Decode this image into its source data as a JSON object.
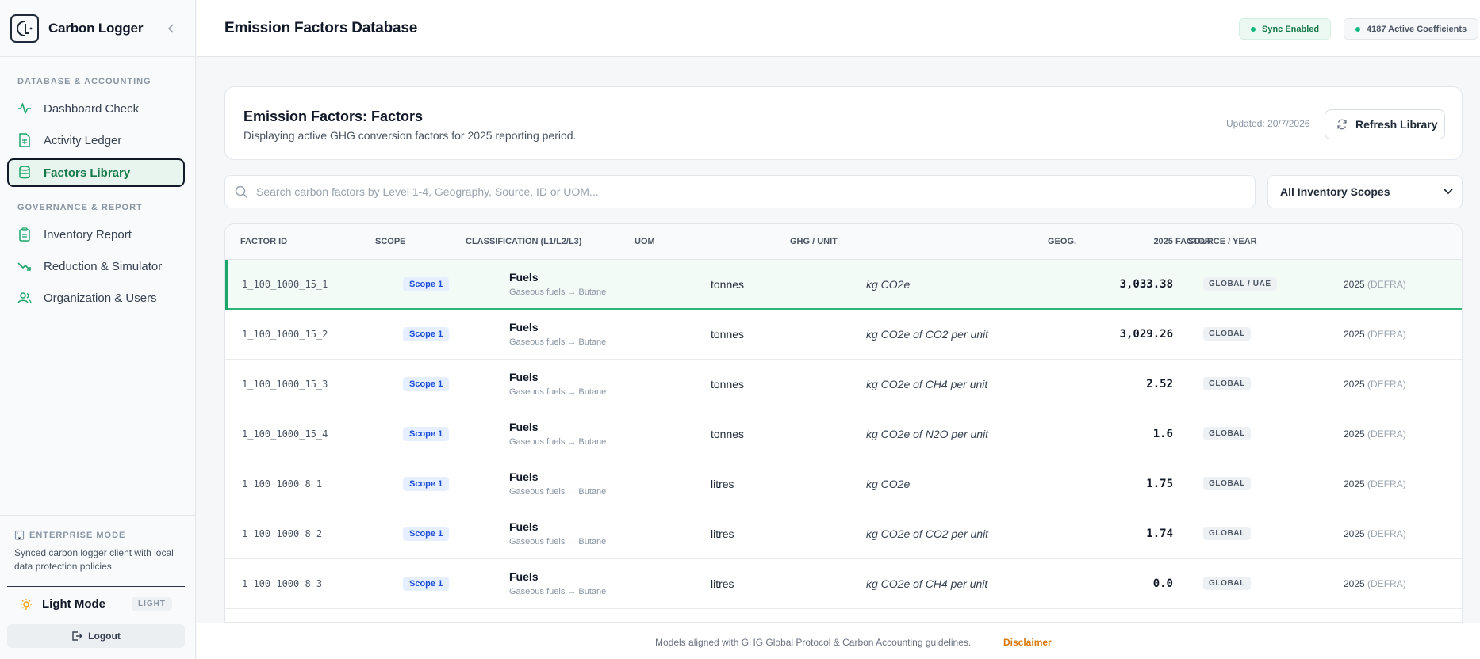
{
  "app": {
    "name": "Carbon Logger"
  },
  "sidebar": {
    "section_database": "DATABASE & ACCOUNTING",
    "section_governance": "GOVERNANCE & REPORT",
    "items": [
      {
        "label": "Dashboard Check",
        "icon": "activity-icon"
      },
      {
        "label": "Activity Ledger",
        "icon": "spreadsheet-icon"
      },
      {
        "label": "Factors Library",
        "icon": "database-icon",
        "active": true
      },
      {
        "label": "Inventory Report",
        "icon": "clipboard-icon"
      },
      {
        "label": "Reduction & Simulator",
        "icon": "trending-down-icon"
      },
      {
        "label": "Organization & Users",
        "icon": "users-icon"
      }
    ],
    "enterprise_title": "ENTERPRISE MODE",
    "enterprise_desc": "Synced carbon logger client with local data protection policies.",
    "mode_label": "Light Mode",
    "mode_badge": "LIGHT",
    "logout_label": "Logout"
  },
  "header": {
    "title": "Emission Factors Database",
    "sync_status": "Sync Enabled",
    "coefficients": "4187 Active Coefficients"
  },
  "card": {
    "title": "Emission Factors: Factors",
    "subtitle": "Displaying active GHG conversion factors for 2025 reporting period.",
    "updated": "Updated: 20/7/2026",
    "refresh_label": "Refresh Library"
  },
  "search": {
    "placeholder": "Search carbon factors by Level 1-4, Geography, Source, ID or UOM...",
    "value": ""
  },
  "scope_filter": {
    "selected": "All Inventory Scopes"
  },
  "table": {
    "columns": [
      "FACTOR ID",
      "SCOPE",
      "CLASSIFICATION (L1/L2/L3)",
      "UOM",
      "GHG / UNIT",
      "2025 FACTOR",
      "GEOG.",
      "SOURCE / YEAR"
    ],
    "rows": [
      {
        "id": "1_100_1000_15_1",
        "scope": "Scope 1",
        "cls": "Fuels",
        "cls_sub": "Gaseous fuels → Butane",
        "uom": "tonnes",
        "ghg": "kg CO2e",
        "factor": "3,033.38",
        "geo": "GLOBAL / UAE",
        "year": "2025",
        "source": "(DEFRA)"
      },
      {
        "id": "1_100_1000_15_2",
        "scope": "Scope 1",
        "cls": "Fuels",
        "cls_sub": "Gaseous fuels → Butane",
        "uom": "tonnes",
        "ghg": "kg CO2e of CO2 per unit",
        "factor": "3,029.26",
        "geo": "GLOBAL",
        "year": "2025",
        "source": "(DEFRA)"
      },
      {
        "id": "1_100_1000_15_3",
        "scope": "Scope 1",
        "cls": "Fuels",
        "cls_sub": "Gaseous fuels → Butane",
        "uom": "tonnes",
        "ghg": "kg CO2e of CH4 per unit",
        "factor": "2.52",
        "geo": "GLOBAL",
        "year": "2025",
        "source": "(DEFRA)"
      },
      {
        "id": "1_100_1000_15_4",
        "scope": "Scope 1",
        "cls": "Fuels",
        "cls_sub": "Gaseous fuels → Butane",
        "uom": "tonnes",
        "ghg": "kg CO2e of N2O per unit",
        "factor": "1.6",
        "geo": "GLOBAL",
        "year": "2025",
        "source": "(DEFRA)"
      },
      {
        "id": "1_100_1000_8_1",
        "scope": "Scope 1",
        "cls": "Fuels",
        "cls_sub": "Gaseous fuels → Butane",
        "uom": "litres",
        "ghg": "kg CO2e",
        "factor": "1.75",
        "geo": "GLOBAL",
        "year": "2025",
        "source": "(DEFRA)"
      },
      {
        "id": "1_100_1000_8_2",
        "scope": "Scope 1",
        "cls": "Fuels",
        "cls_sub": "Gaseous fuels → Butane",
        "uom": "litres",
        "ghg": "kg CO2e of CO2 per unit",
        "factor": "1.74",
        "geo": "GLOBAL",
        "year": "2025",
        "source": "(DEFRA)"
      },
      {
        "id": "1_100_1000_8_3",
        "scope": "Scope 1",
        "cls": "Fuels",
        "cls_sub": "Gaseous fuels → Butane",
        "uom": "litres",
        "ghg": "kg CO2e of CH4 per unit",
        "factor": "0.0",
        "geo": "GLOBAL",
        "year": "2025",
        "source": "(DEFRA)"
      }
    ]
  },
  "footer": {
    "note": "Models aligned with GHG Global Protocol & Carbon Accounting guidelines.",
    "disclaimer": "Disclaimer"
  },
  "colors": {
    "accent": "#16794a",
    "scope_badge": "#1d4ed8",
    "disclaimer": "#d97706"
  }
}
